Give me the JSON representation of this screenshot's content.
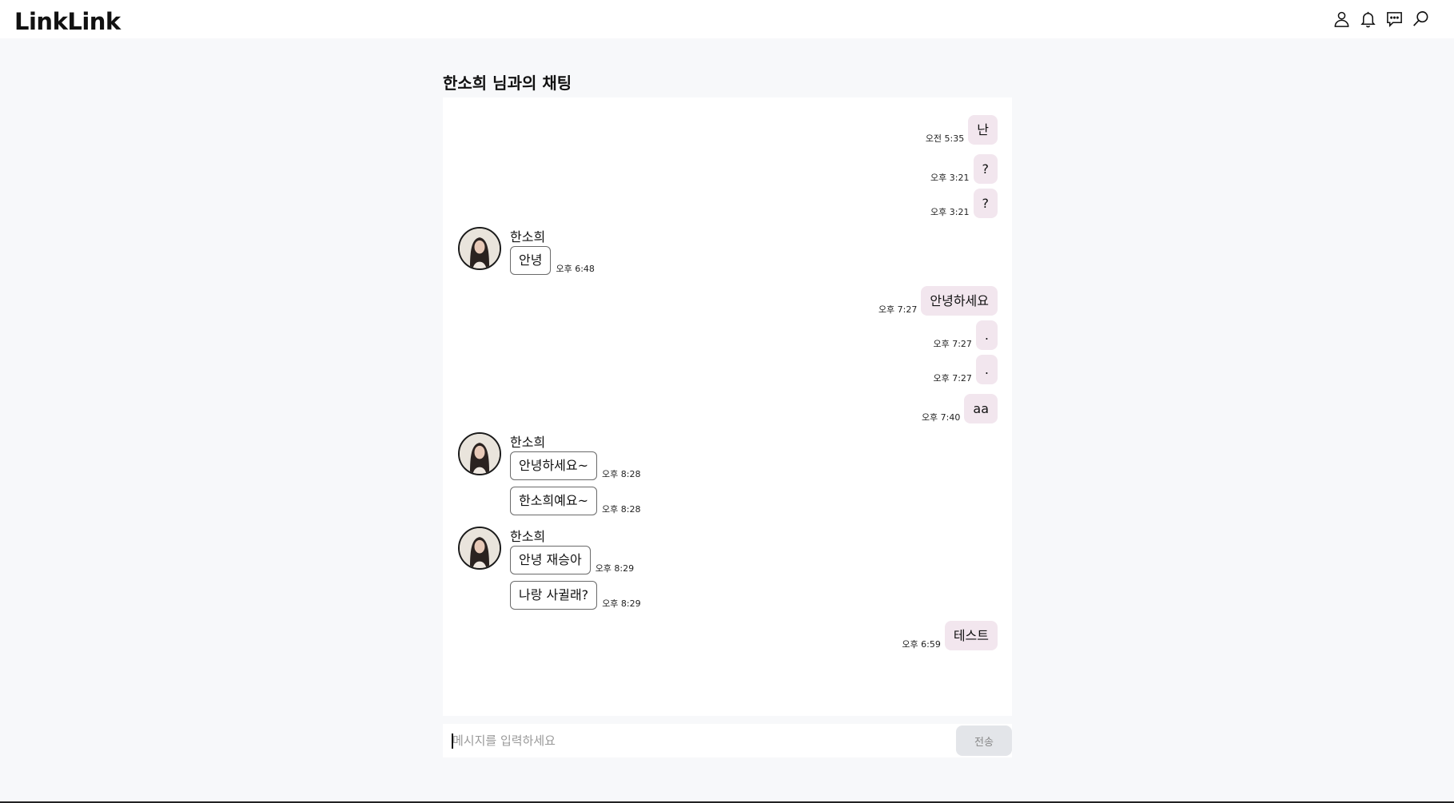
{
  "app": {
    "logo": "LinkLink"
  },
  "header_icons": [
    "user-icon",
    "bell-icon",
    "chat-icon",
    "search-icon"
  ],
  "chat": {
    "title": "한소희 님과의 채팅",
    "partner_name": "한소희",
    "messages": [
      {
        "mine": true,
        "text": "난",
        "time": "오전 5:35"
      },
      {
        "mine": true,
        "text": "?",
        "time": "오후 3:21"
      },
      {
        "mine": true,
        "text": "?",
        "time": "오후 3:21"
      },
      {
        "mine": false,
        "sender": "한소희",
        "text": "안녕",
        "time": "오후 6:48"
      },
      {
        "mine": true,
        "text": "안녕하세요",
        "time": "오후 7:27"
      },
      {
        "mine": true,
        "text": ".",
        "time": "오후 7:27"
      },
      {
        "mine": true,
        "text": ".",
        "time": "오후 7:27"
      },
      {
        "mine": true,
        "text": "aa",
        "time": "오후 7:40"
      },
      {
        "mine": false,
        "sender": "한소희",
        "text": "안녕하세요~",
        "time": "오후 8:28"
      },
      {
        "mine": false,
        "text": "한소희예요~",
        "time": "오후 8:28"
      },
      {
        "mine": false,
        "sender": "한소희",
        "text": "안녕 재승아",
        "time": "오후 8:29"
      },
      {
        "mine": false,
        "text": "나랑 사귈래?",
        "time": "오후 8:29"
      },
      {
        "mine": true,
        "text": "테스트",
        "time": "오후 6:59"
      }
    ]
  },
  "composer": {
    "placeholder": "메시지를 입력하세요",
    "value": "",
    "send_label": "전송"
  },
  "colors": {
    "my_bubble": "#f2e6ee",
    "page_bg": "#f7f8fa",
    "send_button": "#e3e5e9"
  }
}
